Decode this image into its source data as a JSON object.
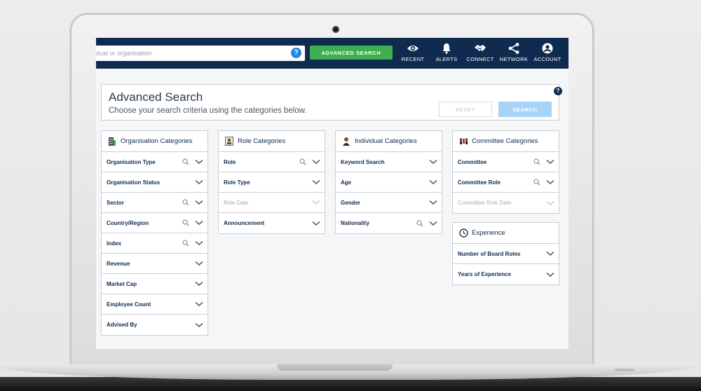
{
  "topbar": {
    "search_placeholder": "dual or organisation",
    "help": "?",
    "advanced_search_label": "ADVANCED SEARCH",
    "nav": [
      {
        "label": "RECENT",
        "icon": "eye-icon"
      },
      {
        "label": "ALERTS",
        "icon": "bell-icon"
      },
      {
        "label": "CONNECT",
        "icon": "handshake-icon"
      },
      {
        "label": "NETWORK",
        "icon": "share-icon"
      },
      {
        "label": "ACCOUNT",
        "icon": "user-icon"
      }
    ]
  },
  "header": {
    "title": "Advanced Search",
    "subtitle": "Choose your search criteria using the categories below.",
    "reset_label": "RESET",
    "search_label": "SEARCH",
    "help": "?"
  },
  "panels": {
    "organisation": {
      "title": "Organisation Categories",
      "icon": "building-icon",
      "rows": [
        {
          "label": "Organisation Type",
          "search": true
        },
        {
          "label": "Organisation Status",
          "search": false
        },
        {
          "label": "Sector",
          "search": true
        },
        {
          "label": "Country/Region",
          "search": true
        },
        {
          "label": "Index",
          "search": true
        },
        {
          "label": "Revenue",
          "search": false
        },
        {
          "label": "Market Cap",
          "search": false
        },
        {
          "label": "Employee Count",
          "search": false
        },
        {
          "label": "Advised By",
          "search": false
        }
      ]
    },
    "role": {
      "title": "Role Categories",
      "icon": "id-card-icon",
      "rows": [
        {
          "label": "Role",
          "search": true
        },
        {
          "label": "Role Type",
          "search": false
        },
        {
          "label": "Role Date",
          "search": false,
          "disabled": true
        },
        {
          "label": "Announcement",
          "search": false
        }
      ]
    },
    "individual": {
      "title": "Individual Categories",
      "icon": "person-icon",
      "rows": [
        {
          "label": "Keyword Search",
          "search": false
        },
        {
          "label": "Age",
          "search": false
        },
        {
          "label": "Gender",
          "search": false
        },
        {
          "label": "Nationality",
          "search": true
        }
      ]
    },
    "committee": {
      "title": "Committee Categories",
      "icon": "committee-icon",
      "rows": [
        {
          "label": "Committee",
          "search": true
        },
        {
          "label": "Committee Role",
          "search": true
        },
        {
          "label": "Committee Role Date",
          "search": false,
          "disabled": true
        }
      ]
    },
    "experience": {
      "title": "Experience",
      "icon": "clock-icon",
      "rows": [
        {
          "label": "Number of Board Roles",
          "search": false
        },
        {
          "label": "Years of Experience",
          "search": false
        }
      ]
    }
  },
  "colors": {
    "nav_bg": "#0f2b4f",
    "accent_green": "#3fb04f",
    "accent_blue": "#1e88e5",
    "search_btn": "#a7d3f7"
  }
}
